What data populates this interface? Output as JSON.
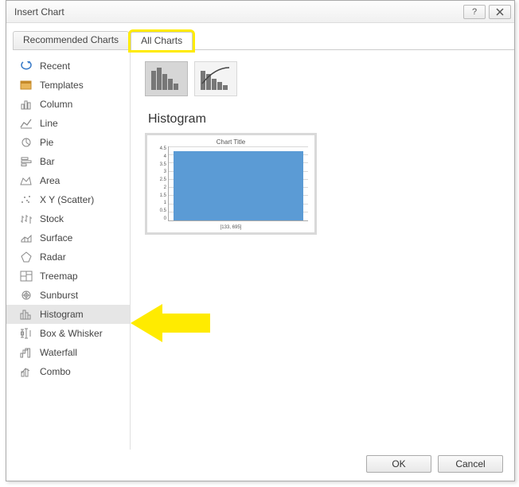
{
  "title": "Insert Chart",
  "tabs": {
    "recommended": "Recommended Charts",
    "all": "All Charts"
  },
  "categories": [
    {
      "label": "Recent"
    },
    {
      "label": "Templates"
    },
    {
      "label": "Column"
    },
    {
      "label": "Line"
    },
    {
      "label": "Pie"
    },
    {
      "label": "Bar"
    },
    {
      "label": "Area"
    },
    {
      "label": "X Y (Scatter)"
    },
    {
      "label": "Stock"
    },
    {
      "label": "Surface"
    },
    {
      "label": "Radar"
    },
    {
      "label": "Treemap"
    },
    {
      "label": "Sunburst"
    },
    {
      "label": "Histogram"
    },
    {
      "label": "Box & Whisker"
    },
    {
      "label": "Waterfall"
    },
    {
      "label": "Combo"
    }
  ],
  "section_title": "Histogram",
  "preview": {
    "title": "Chart Title",
    "yticks": [
      "4.5",
      "4",
      "3.5",
      "3",
      "2.5",
      "2",
      "1.5",
      "1",
      "0.5",
      "0"
    ],
    "xlabel": "[133, 695]"
  },
  "buttons": {
    "ok": "OK",
    "cancel": "Cancel"
  }
}
